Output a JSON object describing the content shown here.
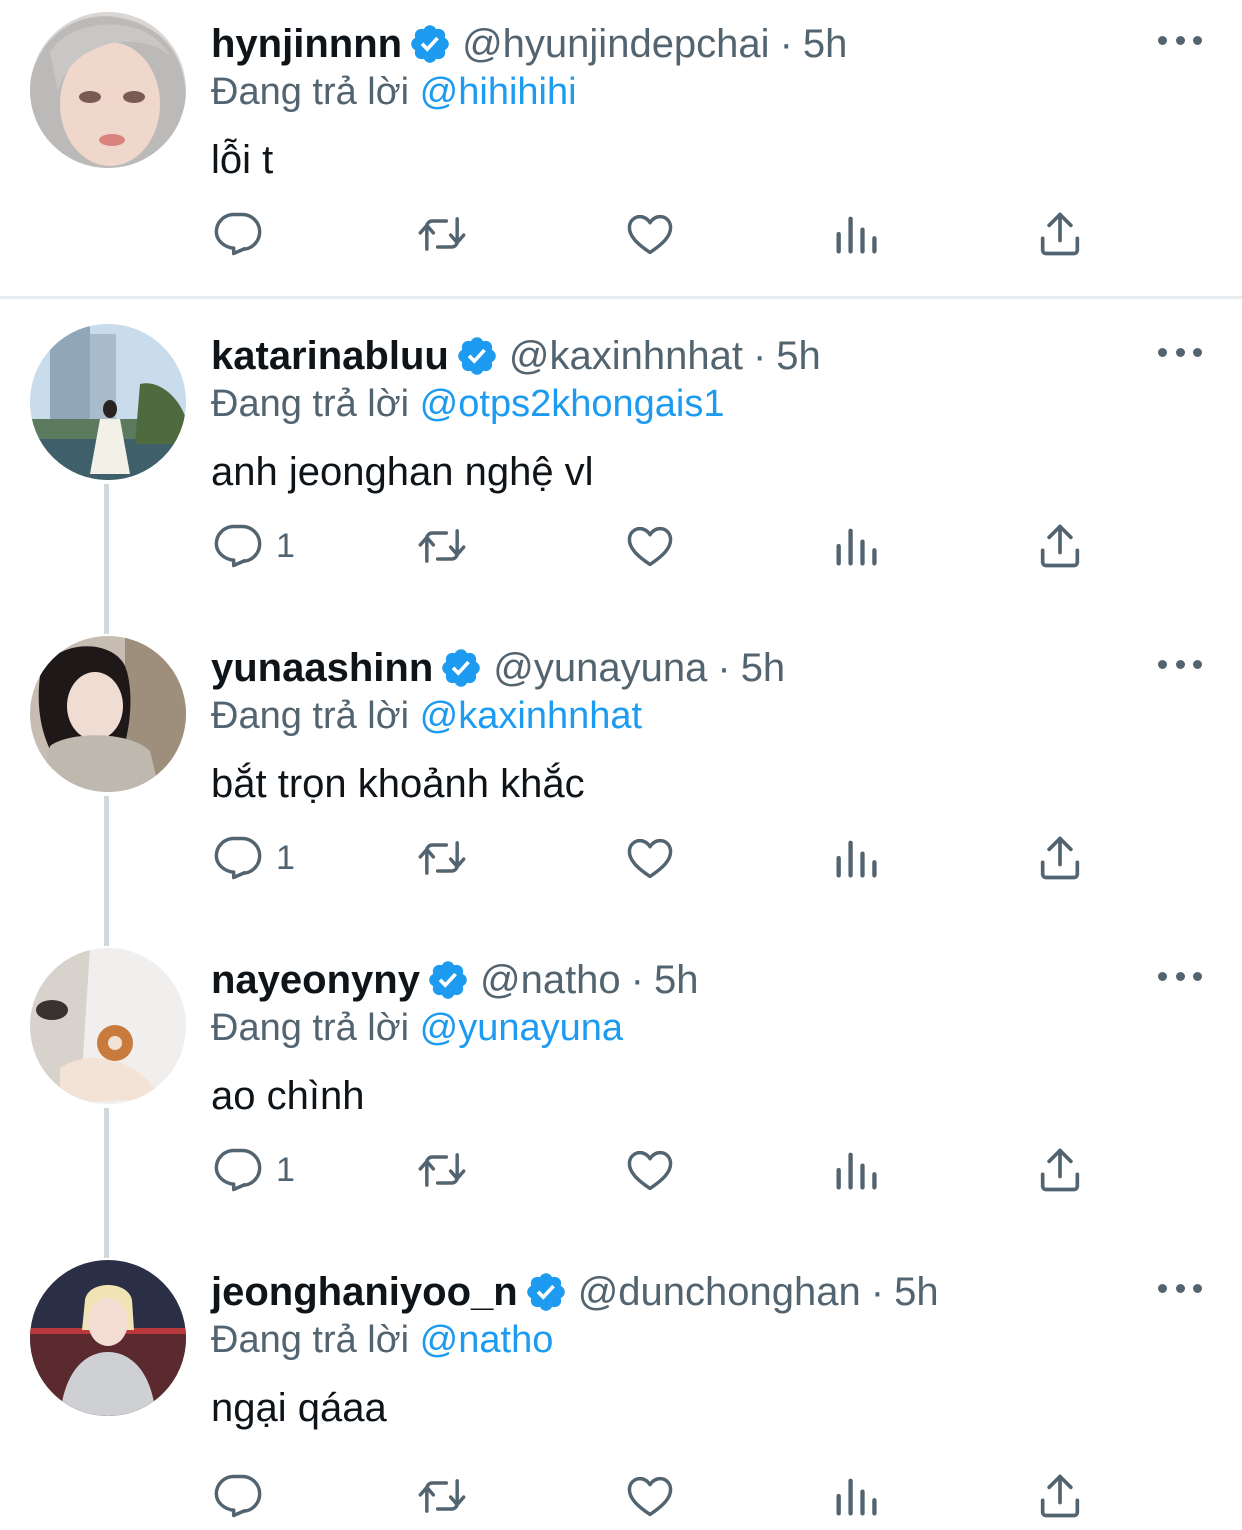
{
  "reply_prefix": "Đang trả lời",
  "colors": {
    "accent": "#1d9bf0",
    "muted": "#536471",
    "text": "#0f1419",
    "thread": "#cfd9de"
  },
  "icons": {
    "reply": "reply-icon",
    "retweet": "retweet-icon",
    "like": "like-icon",
    "views": "views-icon",
    "share": "share-icon",
    "verified": "verified-badge-icon",
    "more": "more-icon"
  },
  "tweets": [
    {
      "name": "hynjinnnn",
      "handle": "@hyunjindepchai",
      "time": "5h",
      "replying_to": "@hihihihi",
      "text": "lỗi t",
      "reply_count": ""
    },
    {
      "name": "katarinabluu",
      "handle": "@kaxinhnhat",
      "time": "5h",
      "replying_to": "@otps2khongais1",
      "text": "anh jeonghan nghệ vl",
      "reply_count": "1"
    },
    {
      "name": "yunaashinn",
      "handle": "@yunayuna",
      "time": "5h",
      "replying_to": "@kaxinhnhat",
      "text": "bắt trọn khoảnh khắc",
      "reply_count": "1"
    },
    {
      "name": "nayeonyny",
      "handle": "@natho",
      "time": "5h",
      "replying_to": "@yunayuna",
      "text": "ao chình",
      "reply_count": "1"
    },
    {
      "name": "jeonghaniyoo_n",
      "handle": "@dunchonghan",
      "time": "5h",
      "replying_to": "@natho",
      "text": "ngại qáaa",
      "reply_count": ""
    }
  ]
}
